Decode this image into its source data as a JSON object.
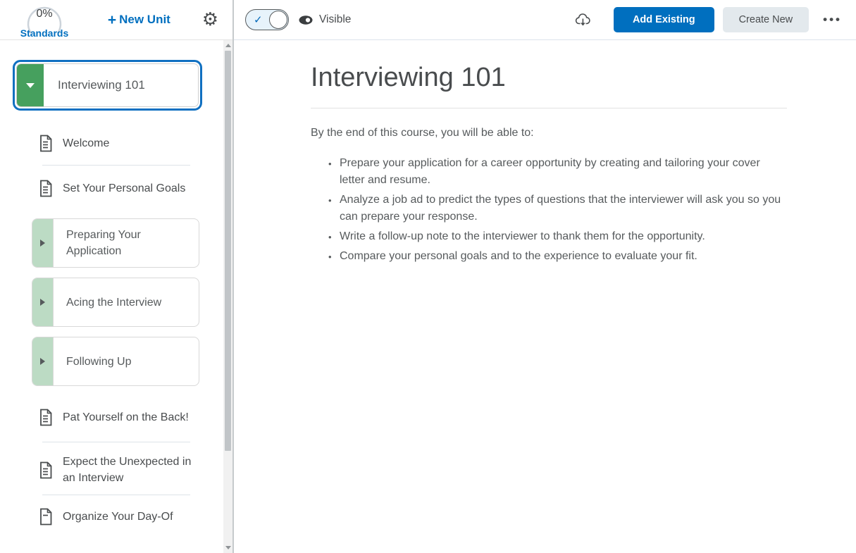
{
  "colors": {
    "accent_blue": "#006fbf",
    "selection_ring_blue": "#1070c1",
    "expanded_strip_green": "#46a05e",
    "collapsed_strip_green": "#bcdbc4",
    "toggle_fill_blue": "#e7f3fb"
  },
  "sidebar": {
    "standards_percent": "0%",
    "standards_label": "Standards",
    "new_unit_label": "New Unit",
    "selected_unit": {
      "title": "Interviewing 101"
    },
    "items": [
      {
        "type": "topic",
        "label": "Welcome"
      },
      {
        "type": "topic",
        "label": "Set Your Personal Goals"
      },
      {
        "type": "unit",
        "label": "Preparing Your Application"
      },
      {
        "type": "unit",
        "label": "Acing the Interview"
      },
      {
        "type": "unit",
        "label": "Following Up"
      },
      {
        "type": "topic",
        "label": "Pat Yourself on the Back!"
      },
      {
        "type": "topic",
        "label": "Expect the Unexpected in an Interview"
      },
      {
        "type": "topic",
        "label": "Organize Your Day-Of"
      }
    ]
  },
  "toolbar": {
    "visible_label": "Visible",
    "add_existing_label": "Add Existing",
    "create_new_label": "Create New",
    "more_label": "•••"
  },
  "content": {
    "title": "Interviewing 101",
    "intro": "By the end of this course, you will be able to:",
    "objectives": [
      "Prepare your application for a career opportunity by creating and tailoring your cover letter and resume.",
      "Analyze a job ad to predict the types of questions that the interviewer will ask you so you can prepare your response.",
      "Write a follow-up note to the interviewer to thank them for the opportunity.",
      "Compare your personal goals and to the experience to evaluate your fit."
    ]
  }
}
